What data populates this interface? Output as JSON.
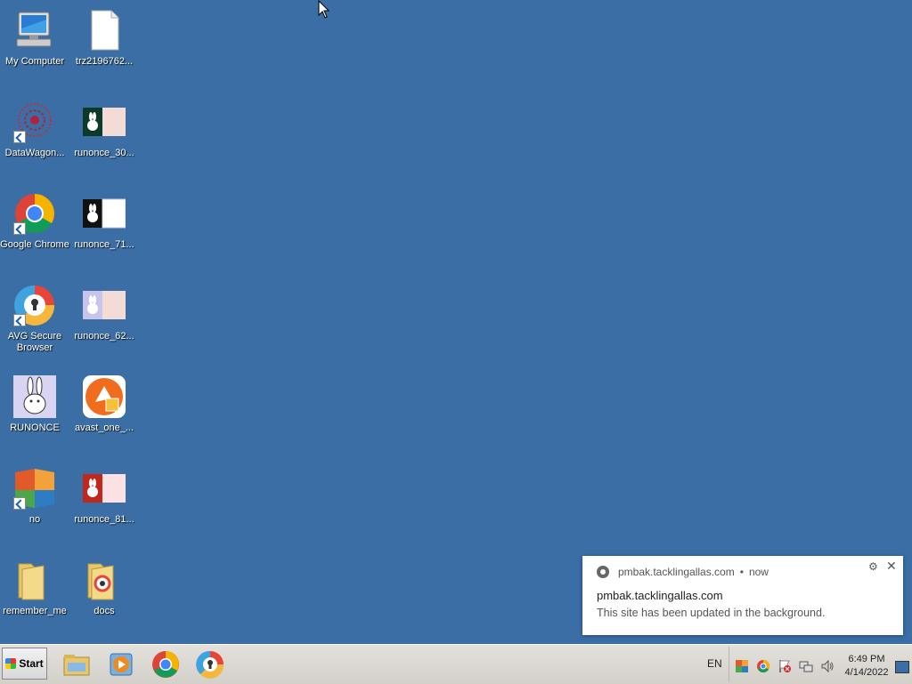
{
  "desktop": {
    "icons": [
      {
        "label": "My Computer",
        "icon": "computer-icon"
      },
      {
        "label": "trz2196762...",
        "icon": "file-icon"
      },
      {
        "label": "DataWagon...",
        "icon": "datawagon-icon"
      },
      {
        "label": "runonce_30...",
        "icon": "image-thumbnail-icon"
      },
      {
        "label": "Google Chrome",
        "icon": "chrome-icon"
      },
      {
        "label": "runonce_71...",
        "icon": "image-thumbnail-icon"
      },
      {
        "label": "AVG Secure Browser",
        "icon": "avg-browser-icon"
      },
      {
        "label": "runonce_62...",
        "icon": "image-thumbnail-icon"
      },
      {
        "label": "RUNONCE",
        "icon": "rabbit-icon"
      },
      {
        "label": "avast_one_...",
        "icon": "avast-icon"
      },
      {
        "label": "no",
        "icon": "avg-icon"
      },
      {
        "label": "runonce_81...",
        "icon": "image-thumbnail-icon"
      },
      {
        "label": "remember_me",
        "icon": "folder-icon"
      },
      {
        "label": "docs",
        "icon": "folder-icon"
      }
    ]
  },
  "notification": {
    "origin": "pmbak.tacklingallas.com",
    "separator": "•",
    "time": "now",
    "title": "pmbak.tacklingallas.com",
    "body": "This site has been updated in the background.",
    "settings_glyph": "⚙",
    "close_glyph": "✕"
  },
  "taskbar": {
    "start_label": "Start",
    "pinned": [
      "explorer-icon",
      "media-player-icon",
      "chrome-icon",
      "avg-browser-icon"
    ],
    "language": "EN",
    "clock_time": "6:49 PM",
    "clock_date": "4/14/2022"
  },
  "colors": {
    "desktop_bg": "#3a6ea5",
    "taskbar_bg": "#d3d0ca"
  }
}
